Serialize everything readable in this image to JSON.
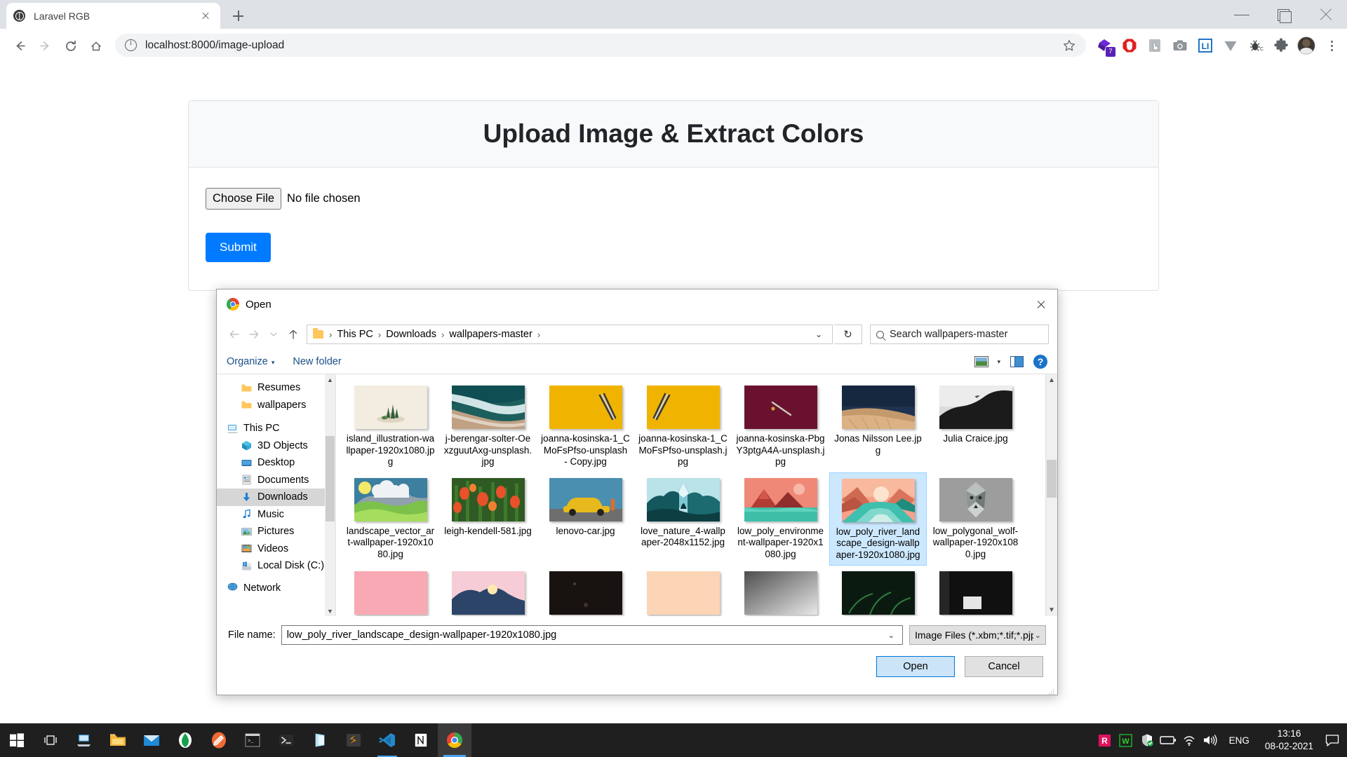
{
  "browser": {
    "tab": {
      "title": "Laravel RGB",
      "favicon": "globe-icon",
      "close": "×"
    },
    "newtab_label": "+",
    "address": {
      "url": "localhost:8000/image-upload",
      "info_icon": "info-icon"
    },
    "extensions": [
      {
        "name": "grammarly-extension",
        "badge": "7"
      },
      {
        "name": "adblock-extension",
        "badge": ""
      },
      {
        "name": "scroll-extension",
        "badge": ""
      },
      {
        "name": "screenshot-extension",
        "badge": ""
      },
      {
        "name": "linkedin-extension",
        "badge": ""
      },
      {
        "name": "vue-devtools-extension",
        "badge": ""
      },
      {
        "name": "debug-bug-extension",
        "badge": ""
      },
      {
        "name": "puzzle-extensions-icon",
        "badge": ""
      }
    ],
    "window_controls": {
      "minimize": "minimize-icon",
      "maximize": "maximize-icon",
      "close": "close-icon"
    }
  },
  "page": {
    "card_title": "Upload Image & Extract Colors",
    "choose_file_label": "Choose File",
    "no_file_text": "No file chosen",
    "submit_label": "Submit"
  },
  "dialog": {
    "title": "Open",
    "breadcrumb": [
      "This PC",
      "Downloads",
      "wallpapers-master"
    ],
    "breadcrumb_sep": "›",
    "search_placeholder": "Search wallpapers-master",
    "refresh_glyph": "↻",
    "toolbar": {
      "organize": "Organize",
      "organize_caret": "▾",
      "new_folder": "New folder",
      "view_caret": "▾",
      "help": "?"
    },
    "sidebar": [
      {
        "label": "Resumes",
        "icon": "folder-icon",
        "indent": 2,
        "selected": false
      },
      {
        "label": "wallpapers",
        "icon": "folder-icon",
        "indent": 2,
        "selected": false
      },
      {
        "label": "This PC",
        "icon": "this-pc-icon",
        "indent": 1,
        "selected": false
      },
      {
        "label": "3D Objects",
        "icon": "3d-objects-icon",
        "indent": 2,
        "selected": false
      },
      {
        "label": "Desktop",
        "icon": "desktop-icon",
        "indent": 2,
        "selected": false
      },
      {
        "label": "Documents",
        "icon": "documents-icon",
        "indent": 2,
        "selected": false
      },
      {
        "label": "Downloads",
        "icon": "downloads-icon",
        "indent": 2,
        "selected": true
      },
      {
        "label": "Music",
        "icon": "music-icon",
        "indent": 2,
        "selected": false
      },
      {
        "label": "Pictures",
        "icon": "pictures-icon",
        "indent": 2,
        "selected": false
      },
      {
        "label": "Videos",
        "icon": "videos-icon",
        "indent": 2,
        "selected": false
      },
      {
        "label": "Local Disk (C:)",
        "icon": "disk-icon",
        "indent": 2,
        "selected": false
      },
      {
        "label": "Network",
        "icon": "network-icon",
        "indent": 1,
        "selected": false
      }
    ],
    "files": [
      {
        "name": "island_illustration-wallpaper-1920x1080.jpg",
        "thumb": "island-illustration",
        "selected": false
      },
      {
        "name": "j-berengar-solter-OexzguutAxg-unsplash.jpg",
        "thumb": "beach-aerial",
        "selected": false
      },
      {
        "name": "joanna-kosinska-1_CMoFsPfso-unsplash - Copy.jpg",
        "thumb": "yellow-pencils",
        "selected": false
      },
      {
        "name": "joanna-kosinska-1_CMoFsPfso-unsplash.jpg",
        "thumb": "yellow-pencils",
        "selected": false
      },
      {
        "name": "joanna-kosinska-PbgY3ptgA4A-unsplash.jpg",
        "thumb": "maroon-pen",
        "selected": false
      },
      {
        "name": "Jonas Nilsson Lee.jpg",
        "thumb": "dock-water",
        "selected": false
      },
      {
        "name": "Julia Craice.jpg",
        "thumb": "bird-mountain",
        "selected": false
      },
      {
        "name": "landscape_vector_art-wallpaper-1920x1080.jpg",
        "thumb": "vector-landscape",
        "selected": false
      },
      {
        "name": "leigh-kendell-581.jpg",
        "thumb": "tulips",
        "selected": false
      },
      {
        "name": "lenovo-car.jpg",
        "thumb": "yellow-car",
        "selected": false
      },
      {
        "name": "love_nature_4-wallpaper-2048x1152.jpg",
        "thumb": "teal-forest",
        "selected": false
      },
      {
        "name": "low_poly_environment-wallpaper-1920x1080.jpg",
        "thumb": "low-poly-red",
        "selected": false
      },
      {
        "name": "low_poly_river_landscape_design-wallpaper-1920x1080.jpg",
        "thumb": "low-poly-river",
        "selected": true
      },
      {
        "name": "low_polygonal_wolf-wallpaper-1920x1080.jpg",
        "thumb": "poly-wolf",
        "selected": false
      }
    ],
    "partial_row": [
      {
        "thumb": "pink-flat"
      },
      {
        "thumb": "sunset-peak"
      },
      {
        "thumb": "dark-room"
      },
      {
        "thumb": "peach-flat"
      },
      {
        "thumb": "grey-gradient"
      },
      {
        "thumb": "green-fern"
      },
      {
        "thumb": "dark-desk"
      }
    ],
    "footer": {
      "file_name_label": "File name:",
      "file_name_value": "low_poly_river_landscape_design-wallpaper-1920x1080.jpg",
      "file_type_value": "Image Files (*.xbm;*.tif;*.pjp;*.sv",
      "open_label": "Open",
      "cancel_label": "Cancel",
      "caret": "⌄"
    }
  },
  "taskbar": {
    "items": [
      {
        "name": "start-button",
        "icon": "windows-logo"
      },
      {
        "name": "task-view-button",
        "icon": "task-view-icon"
      },
      {
        "name": "taskbar-this-pc",
        "icon": "this-pc-icon"
      },
      {
        "name": "taskbar-file-explorer",
        "icon": "folder-icon"
      },
      {
        "name": "taskbar-mail",
        "icon": "mail-icon"
      },
      {
        "name": "taskbar-mongodb",
        "icon": "mongodb-icon"
      },
      {
        "name": "taskbar-postman",
        "icon": "postman-icon"
      },
      {
        "name": "taskbar-terminal",
        "icon": "terminal-icon"
      },
      {
        "name": "taskbar-powershell",
        "icon": "powershell-icon"
      },
      {
        "name": "taskbar-office",
        "icon": "office-icon"
      },
      {
        "name": "taskbar-sublime",
        "icon": "sublime-icon"
      },
      {
        "name": "taskbar-vscode",
        "icon": "vscode-icon"
      },
      {
        "name": "taskbar-notion",
        "icon": "notion-icon"
      },
      {
        "name": "taskbar-chrome",
        "icon": "chrome-icon"
      }
    ],
    "tray": [
      {
        "name": "tray-r-icon",
        "label": "R"
      },
      {
        "name": "tray-w-icon",
        "label": "W"
      },
      {
        "name": "tray-security-icon",
        "label": ""
      },
      {
        "name": "tray-battery-icon",
        "label": ""
      },
      {
        "name": "tray-wifi-icon",
        "label": ""
      },
      {
        "name": "tray-volume-icon",
        "label": ""
      }
    ],
    "language": "ENG",
    "time": "13:16",
    "date": "08-02-2021"
  },
  "colors": {
    "accent_blue": "#007bff",
    "selection_blue": "#cce8ff",
    "chrome_tabstrip": "#dee1e6",
    "taskbar": "#1f1f1f"
  }
}
